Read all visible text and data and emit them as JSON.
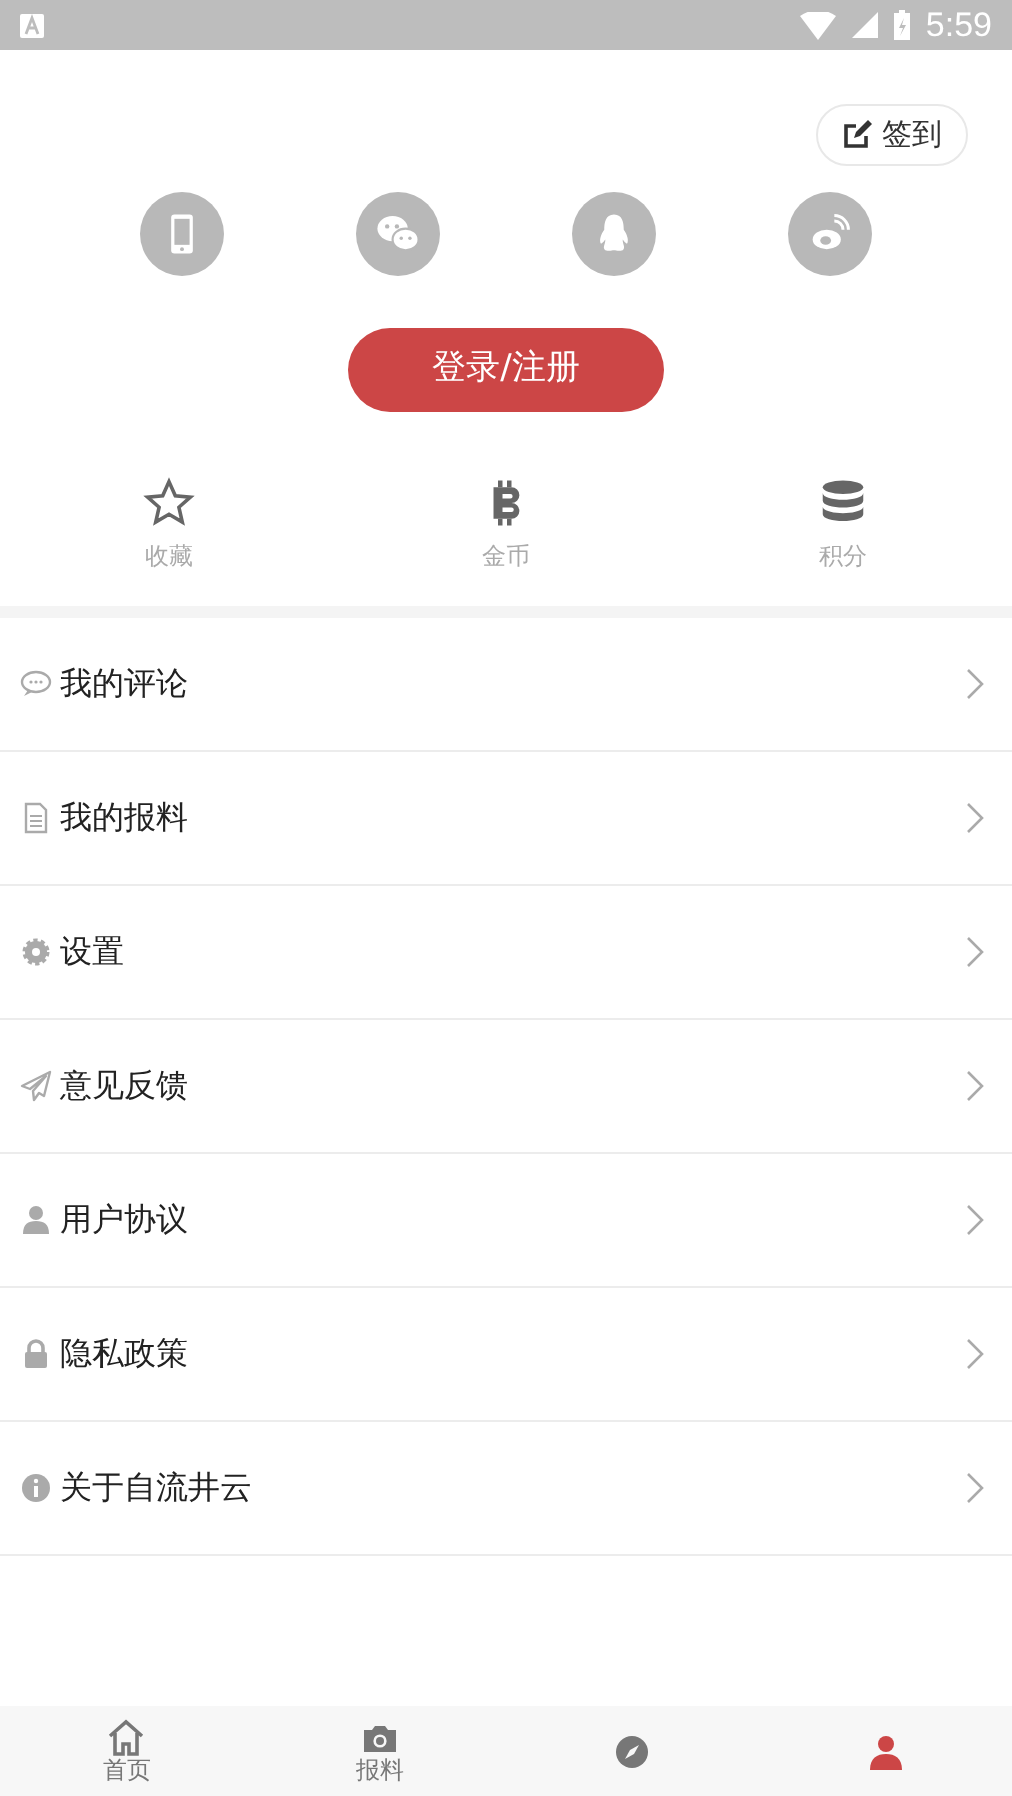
{
  "status_bar": {
    "time": "5:59"
  },
  "checkin_button": {
    "label": "签到"
  },
  "login_options": [
    {
      "kind": "phone"
    },
    {
      "kind": "wechat"
    },
    {
      "kind": "qq"
    },
    {
      "kind": "weibo"
    }
  ],
  "login_button": {
    "label": "登录/注册"
  },
  "stats": [
    {
      "kind": "star",
      "label": "收藏"
    },
    {
      "kind": "coin",
      "label": "金币"
    },
    {
      "kind": "stack",
      "label": "积分"
    }
  ],
  "menu": [
    {
      "kind": "comment",
      "label": "我的评论"
    },
    {
      "kind": "document",
      "label": "我的报料"
    },
    {
      "kind": "gear",
      "label": "设置"
    },
    {
      "kind": "send",
      "label": "意见反馈"
    },
    {
      "kind": "user",
      "label": "用户协议"
    },
    {
      "kind": "lock",
      "label": "隐私政策"
    },
    {
      "kind": "info",
      "label": "关于自流井云"
    }
  ],
  "bottom_nav": [
    {
      "kind": "home",
      "label": "首页",
      "selected": false
    },
    {
      "kind": "camera",
      "label": "报料",
      "selected": false
    },
    {
      "kind": "compass",
      "selected": false
    },
    {
      "kind": "person",
      "selected": true
    }
  ]
}
